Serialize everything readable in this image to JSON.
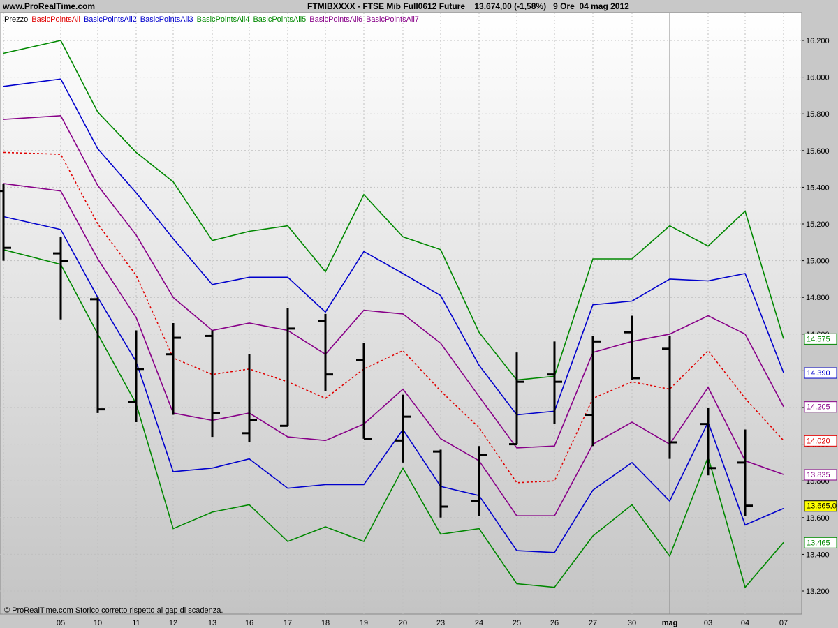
{
  "header": {
    "site": "www.ProRealTime.com",
    "title": "FTMIBXXXX - FTSE Mib Full0612 Future    13.674,00 (-1,58%)   9 Ore  04 mag 2012"
  },
  "legend": [
    {
      "label": "Prezzo",
      "color": "#000000"
    },
    {
      "label": "BasicPointsAll",
      "color": "#e00000"
    },
    {
      "label": "BasicPointsAll2",
      "color": "#0000cc"
    },
    {
      "label": "BasicPointsAll3",
      "color": "#0000cc"
    },
    {
      "label": "BasicPointsAll4",
      "color": "#008800"
    },
    {
      "label": "BasicPointsAll5",
      "color": "#008800"
    },
    {
      "label": "BasicPointsAll6",
      "color": "#880088"
    },
    {
      "label": "BasicPointsAll7",
      "color": "#880088"
    }
  ],
  "footer_note": "© ProRealTime.com  Storico corretto rispetto al gap di scadenza.",
  "chart_data": {
    "type": "line",
    "x": [
      "",
      "05",
      "10",
      "11",
      "12",
      "13",
      "16",
      "17",
      "18",
      "19",
      "20",
      "23",
      "24",
      "25",
      "26",
      "27",
      "30",
      "mag",
      "03",
      "04",
      "07"
    ],
    "ylim": [
      13050,
      16300
    ],
    "yticks": [
      "13.200",
      "13.400",
      "13.600",
      "13.800",
      "14.000",
      "14.200",
      "14.400",
      "14.600",
      "14.800",
      "15.000",
      "15.200",
      "15.400",
      "15.600",
      "15.800",
      "16.000",
      "16.200"
    ],
    "series": [
      {
        "name": "BasicPointsAll",
        "color": "#e00000",
        "dashed": true,
        "values": [
          15590,
          15580,
          15200,
          14920,
          14470,
          14380,
          14410,
          14340,
          14250,
          14410,
          14510,
          14290,
          14090,
          13790,
          13800,
          14250,
          14340,
          14300,
          14510,
          14250,
          14020
        ]
      },
      {
        "name": "BasicPointsAll2",
        "color": "#0000cc",
        "values": [
          15950,
          15990,
          15610,
          15370,
          15120,
          14870,
          14910,
          14910,
          14720,
          15050,
          14930,
          14810,
          14430,
          14160,
          14180,
          14760,
          14780,
          14900,
          14890,
          14930,
          14390
        ]
      },
      {
        "name": "BasicPointsAll3",
        "color": "#0000cc",
        "values": [
          15240,
          15170,
          14800,
          14450,
          13850,
          13870,
          13920,
          13760,
          13780,
          13780,
          14080,
          13770,
          13720,
          13420,
          13410,
          13750,
          13900,
          13690,
          14120,
          13560,
          13650
        ]
      },
      {
        "name": "BasicPointsAll4",
        "color": "#008800",
        "values": [
          16130,
          16200,
          15810,
          15590,
          15430,
          15110,
          15160,
          15190,
          14940,
          15360,
          15130,
          15060,
          14610,
          14350,
          14370,
          15010,
          15010,
          15190,
          15080,
          15270,
          14575
        ]
      },
      {
        "name": "BasicPointsAll5",
        "color": "#008800",
        "values": [
          15060,
          14980,
          14600,
          14220,
          13540,
          13630,
          13670,
          13470,
          13550,
          13470,
          13870,
          13510,
          13540,
          13240,
          13220,
          13500,
          13670,
          13390,
          13930,
          13220,
          13465
        ]
      },
      {
        "name": "BasicPointsAll6",
        "color": "#880088",
        "values": [
          15770,
          15790,
          15410,
          15140,
          14800,
          14620,
          14660,
          14620,
          14490,
          14730,
          14710,
          14550,
          14260,
          13980,
          13990,
          14500,
          14560,
          14600,
          14700,
          14600,
          14205
        ]
      },
      {
        "name": "BasicPointsAll7",
        "color": "#880088",
        "values": [
          15420,
          15380,
          15010,
          14690,
          14170,
          14130,
          14170,
          14040,
          14020,
          14110,
          14300,
          14030,
          13910,
          13610,
          13610,
          14000,
          14120,
          14000,
          14310,
          13910,
          13835
        ]
      }
    ],
    "ohlc": [
      {
        "h": 15420,
        "l": 15000,
        "o": 15380,
        "c": 15070
      },
      {
        "h": 15130,
        "l": 14680,
        "o": 15040,
        "c": 15000
      },
      {
        "h": 14800,
        "l": 14170,
        "o": 14790,
        "c": 14190
      },
      {
        "h": 14620,
        "l": 14120,
        "o": 14230,
        "c": 14410
      },
      {
        "h": 14660,
        "l": 14160,
        "o": 14490,
        "c": 14580
      },
      {
        "h": 14620,
        "l": 14040,
        "o": 14590,
        "c": 14170
      },
      {
        "h": 14490,
        "l": 14010,
        "o": 14060,
        "c": 14130
      },
      {
        "h": 14740,
        "l": 14100,
        "o": 14100,
        "c": 14630
      },
      {
        "h": 14710,
        "l": 14290,
        "o": 14670,
        "c": 14380
      },
      {
        "h": 14550,
        "l": 14030,
        "o": 14460,
        "c": 14030
      },
      {
        "h": 14270,
        "l": 13900,
        "o": 14020,
        "c": 14150
      },
      {
        "h": 13970,
        "l": 13600,
        "o": 13960,
        "c": 13660
      },
      {
        "h": 13990,
        "l": 13610,
        "o": 13690,
        "c": 13940
      },
      {
        "h": 14500,
        "l": 14000,
        "o": 14000,
        "c": 14340
      },
      {
        "h": 14560,
        "l": 14110,
        "o": 14380,
        "c": 14340
      },
      {
        "h": 14590,
        "l": 13990,
        "o": 14160,
        "c": 14560
      },
      {
        "h": 14700,
        "l": 14350,
        "o": 14610,
        "c": 14360
      },
      {
        "h": 14590,
        "l": 13920,
        "o": 14520,
        "c": 14010
      },
      {
        "h": 14200,
        "l": 13830,
        "o": 14110,
        "c": 13870
      },
      {
        "h": 14080,
        "l": 13610,
        "o": 13900,
        "c": 13665
      }
    ],
    "last_value_labels": [
      {
        "text": "14.575",
        "value": 14575,
        "color": "#008800"
      },
      {
        "text": "14.390",
        "value": 14390,
        "color": "#0000cc"
      },
      {
        "text": "14.205",
        "value": 14205,
        "color": "#880088"
      },
      {
        "text": "14.020",
        "value": 14020,
        "color": "#e00000"
      },
      {
        "text": "13.835",
        "value": 13835,
        "color": "#880088"
      },
      {
        "text": "13.665,0",
        "value": 13665,
        "color": "#000000",
        "highlight": true
      },
      {
        "text": "13.465",
        "value": 13465,
        "color": "#008800"
      }
    ]
  }
}
